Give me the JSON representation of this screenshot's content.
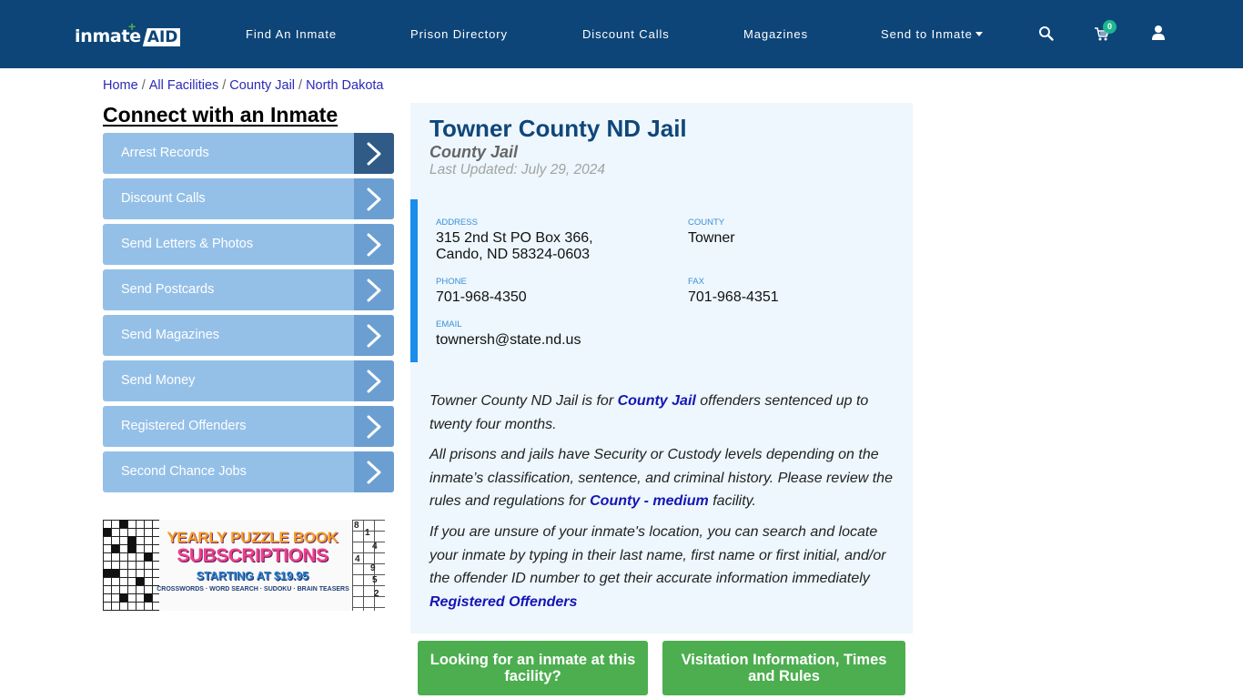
{
  "header": {
    "logo": {
      "text": "inmate",
      "accent": "AID"
    },
    "nav": [
      {
        "label": "Find An Inmate"
      },
      {
        "label": "Prison Directory"
      },
      {
        "label": "Discount Calls"
      },
      {
        "label": "Magazines"
      },
      {
        "label": "Send to Inmate",
        "has_dropdown": true
      }
    ],
    "icons": [
      "search-icon",
      "cart-icon",
      "user-icon"
    ],
    "cart_count": "0",
    "colors": {
      "background": "#0d4578",
      "badge": "#1db88f"
    }
  },
  "breadcrumb": [
    {
      "label": "Home"
    },
    {
      "label": "All Facilities"
    },
    {
      "label": "County Jail"
    },
    {
      "label": "North Dakota"
    }
  ],
  "sidebar": {
    "title": "Connect with an Inmate",
    "items": [
      {
        "label": "Arrest Records",
        "active": true
      },
      {
        "label": "Discount Calls"
      },
      {
        "label": "Send Letters & Photos"
      },
      {
        "label": "Send Postcards"
      },
      {
        "label": "Send Magazines"
      },
      {
        "label": "Send Money"
      },
      {
        "label": "Registered Offenders"
      },
      {
        "label": "Second Chance Jobs"
      }
    ],
    "ad": {
      "line1": "YEARLY PUZZLE BOOK",
      "line2": "SUBSCRIPTIONS",
      "line3": "STARTING AT $19.95",
      "line4": "CROSSWORDS · WORD SEARCH · SUDOKU · BRAIN TEASERS",
      "sudoku_digits": [
        "8",
        "1",
        "4",
        "4",
        "9",
        "5",
        "2"
      ]
    }
  },
  "facility": {
    "name": "Towner County ND Jail",
    "type": "County Jail",
    "last_updated": "Last Updated: July 29, 2024",
    "info": {
      "address_label": "ADDRESS",
      "address_line1": "315 2nd St PO Box 366,",
      "address_line2": "Cando, ND 58324-0603",
      "county_label": "COUNTY",
      "county": "Towner",
      "phone_label": "PHONE",
      "phone": "701-968-4350",
      "fax_label": "FAX",
      "fax": "701-968-4351",
      "email_label": "EMAIL",
      "email": "townersh@state.nd.us"
    },
    "description": {
      "p1_before": "Towner County ND Jail is for ",
      "p1_link": "County Jail",
      "p1_after": " offenders sentenced up to twenty four months.",
      "p2_before": "All prisons and jails have Security or Custody levels depending on the inmate’s classification, sentence, and criminal history. Please review the rules and regulations for ",
      "p2_link": "County - medium",
      "p2_after": " facility.",
      "p3": "If you are unsure of your inmate's location, you can search and locate your inmate by typing in their last name, first name or first initial, and/or the offender ID number to get their accurate information immediately",
      "p3_link": "Registered Offenders"
    }
  },
  "buttons": {
    "find_inmate": "Looking for an inmate at this facility?",
    "visitation": "Visitation Information, Times and Rules"
  }
}
